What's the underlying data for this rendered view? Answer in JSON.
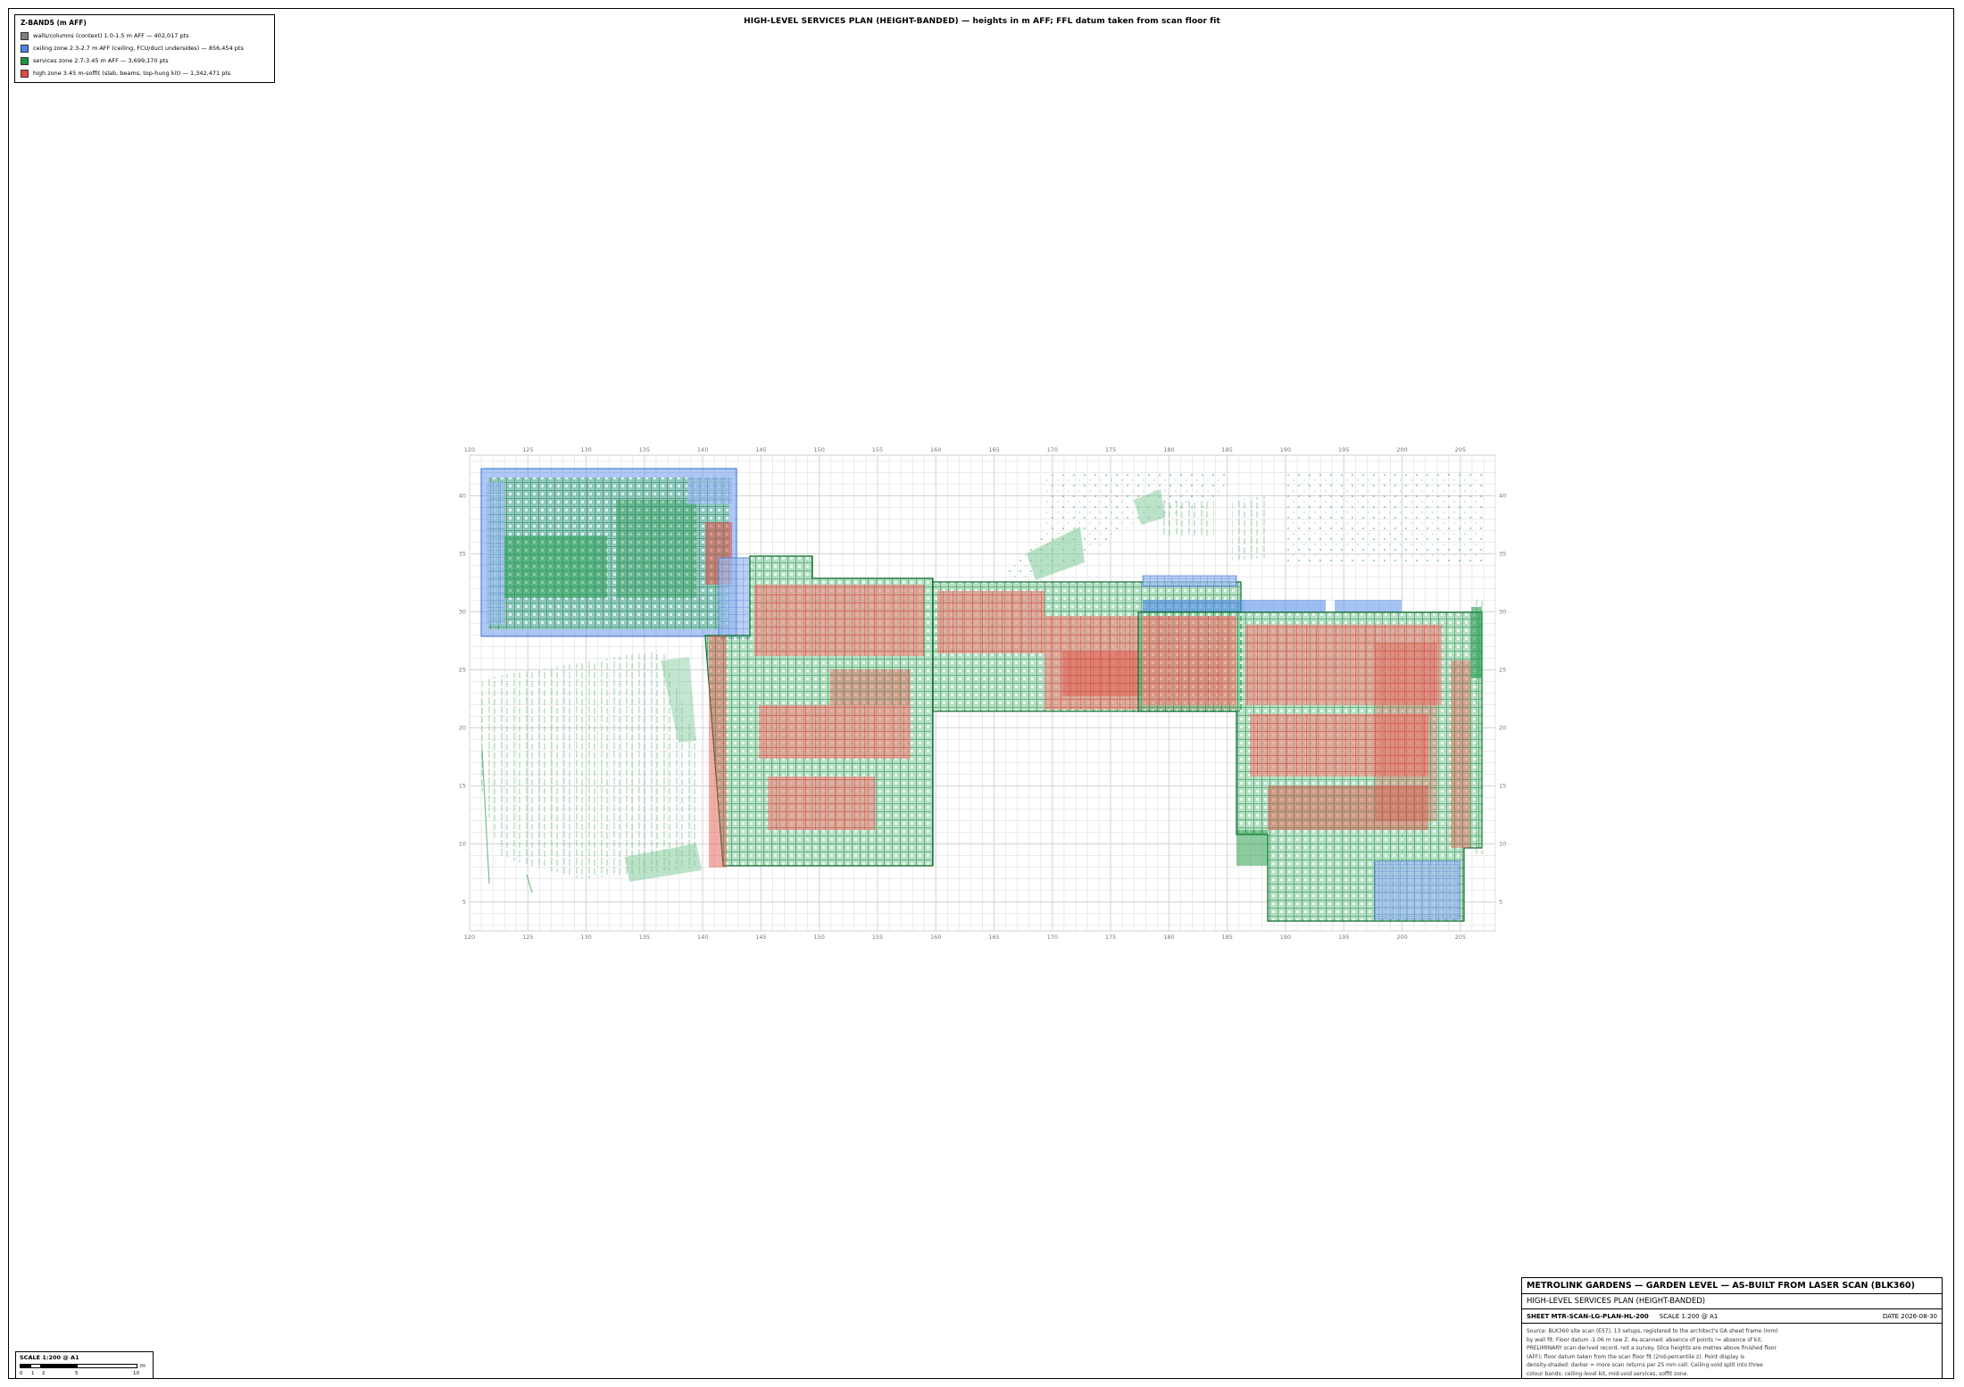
{
  "sheet_title": "HIGH-LEVEL SERVICES PLAN (HEIGHT-BANDED)  —  heights in m AFF; FFL datum taken from scan floor fit",
  "legend": {
    "title": "Z-BANDS (m AFF)",
    "items": [
      {
        "label": "walls/columns (context) 1.0-1.5 m AFF — 402,017 pts",
        "color": "#7f7f7f"
      },
      {
        "label": "ceiling zone 2.3-2.7 m AFF (ceiling, FCU/duct undersides) — 856,454 pts",
        "color": "#4a86e8"
      },
      {
        "label": "services zone 2.7-3.45 m AFF — 3,699,170 pts",
        "color": "#1a9641"
      },
      {
        "label": "high zone 3.45 m-soffit (slab, beams, top-hung kit) — 1,342,471 pts",
        "color": "#e04b3f"
      }
    ]
  },
  "plan": {
    "x_axis": {
      "ticks": [
        120,
        125,
        130,
        135,
        140,
        145,
        150,
        155,
        160,
        165,
        170,
        175,
        180,
        185,
        190,
        195,
        200,
        205
      ],
      "range": [
        120,
        208
      ]
    },
    "y_axis": {
      "ticks": [
        5,
        10,
        15,
        20,
        25,
        30,
        35,
        40
      ],
      "range": [
        2.5,
        43.5
      ]
    },
    "grid": true,
    "colors": {
      "services": "#1a9641",
      "ceiling": "#4a86e8",
      "high": "#e04b3f",
      "walls": "#7f7f7f"
    }
  },
  "title_block": {
    "project": "METROLINK GARDENS — GARDEN LEVEL — AS-BUILT FROM LASER SCAN (BLK360)",
    "drawing": "HIGH-LEVEL SERVICES PLAN (HEIGHT-BANDED)",
    "sheet": "SHEET MTR-SCAN-LG-PLAN-HL-200",
    "scale": "SCALE 1:200 @ A1",
    "date": "DATE 2026-08-30",
    "notes": [
      "Source: BLK360 site scan (E57), 13 setups, registered to the architect's GA sheet frame (mm)",
      "by wall fit. Floor datum -1.06 m raw Z. As-scanned: absence of points != absence of kit.",
      "PRELIMINARY scan-derived record, not a survey. Slice heights are metres above finished floor",
      "(AFF); floor datum taken from the scan floor fit (2nd-percentile z). Point display is",
      "density-shaded: darker = more scan returns per 25 mm cell. Ceiling-void split into three",
      "colour bands: ceiling-level kit, mid-void services, soffit zone."
    ]
  },
  "scale_bar": {
    "title": "SCALE 1:200 @ A1",
    "unit": "m",
    "ticks": [
      "0",
      "1",
      "2",
      "5",
      "10"
    ]
  }
}
